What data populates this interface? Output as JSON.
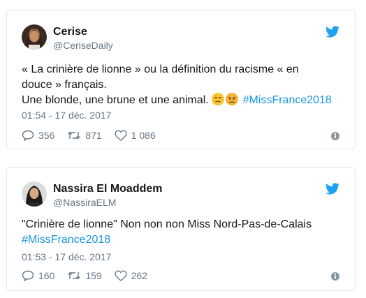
{
  "tweets": [
    {
      "display_name": "Cerise",
      "handle": "@CeriseDaily",
      "text_line1": "« La crinière de lionne » ou la définition du racisme « en",
      "text_line2": "douce » français.",
      "text_line3_prefix": "Une blonde, une brune et une animal. ",
      "hashtag": "#MissFrance2018",
      "timestamp": "01:54 - 17 déc. 2017",
      "replies": "356",
      "retweets": "871",
      "likes": "1 086"
    },
    {
      "display_name": "Nassira El Moaddem",
      "handle": "@NassiraELM",
      "text_line1": "\"Crinière de lionne\" Non non non Miss Nord-Pas-de-Calais",
      "hashtag": "#MissFrance2018",
      "timestamp": "01:53 - 17 déc. 2017",
      "replies": "160",
      "retweets": "159",
      "likes": "262"
    }
  ],
  "icons": {
    "brand": "twitter-bird-icon",
    "reply": "reply-icon",
    "retweet": "retweet-icon",
    "like": "heart-icon",
    "info": "info-icon"
  },
  "colors": {
    "brand": "#1da1f2",
    "hashtag": "#1b95e0",
    "meta": "#657786"
  }
}
